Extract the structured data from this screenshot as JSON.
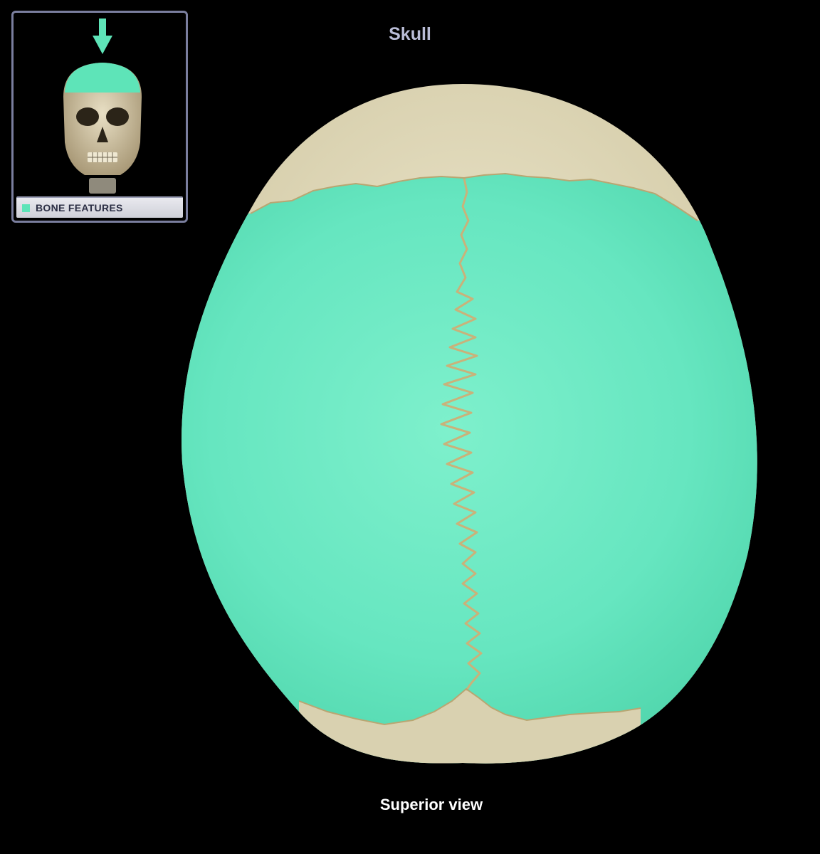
{
  "title": "Skull",
  "caption": "Superior view",
  "inset": {
    "legend_label": "BONE FEATURES"
  },
  "colors": {
    "background": "#000000",
    "highlight": "#5ee4b8",
    "bone": "#ddd7b8",
    "title": "#b9bcd6",
    "caption": "#ffffff"
  }
}
